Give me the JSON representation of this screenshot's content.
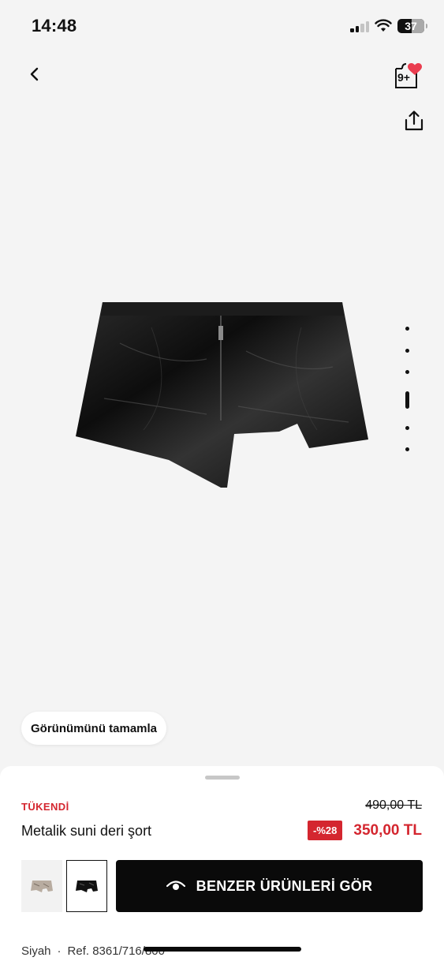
{
  "status": {
    "time": "14:48",
    "battery": "37"
  },
  "header": {
    "bag_count": "9+"
  },
  "gallery": {
    "dot_count": 6,
    "active_index": 3
  },
  "complete_look": {
    "label": "Görünümünü tamamla"
  },
  "product": {
    "availability": "TÜKENDİ",
    "name": "Metalik suni deri şort",
    "old_price": "490,00 TL",
    "discount": "-%28",
    "price": "350,00 TL",
    "color": "Siyah",
    "separator": "·",
    "ref": "Ref. 8361/716/800"
  },
  "actions": {
    "similar_label": "BENZER ÜRÜNLERİ GÖR"
  },
  "colors": {
    "accent_red": "#d4262f",
    "button_black": "#0a0a0a"
  }
}
